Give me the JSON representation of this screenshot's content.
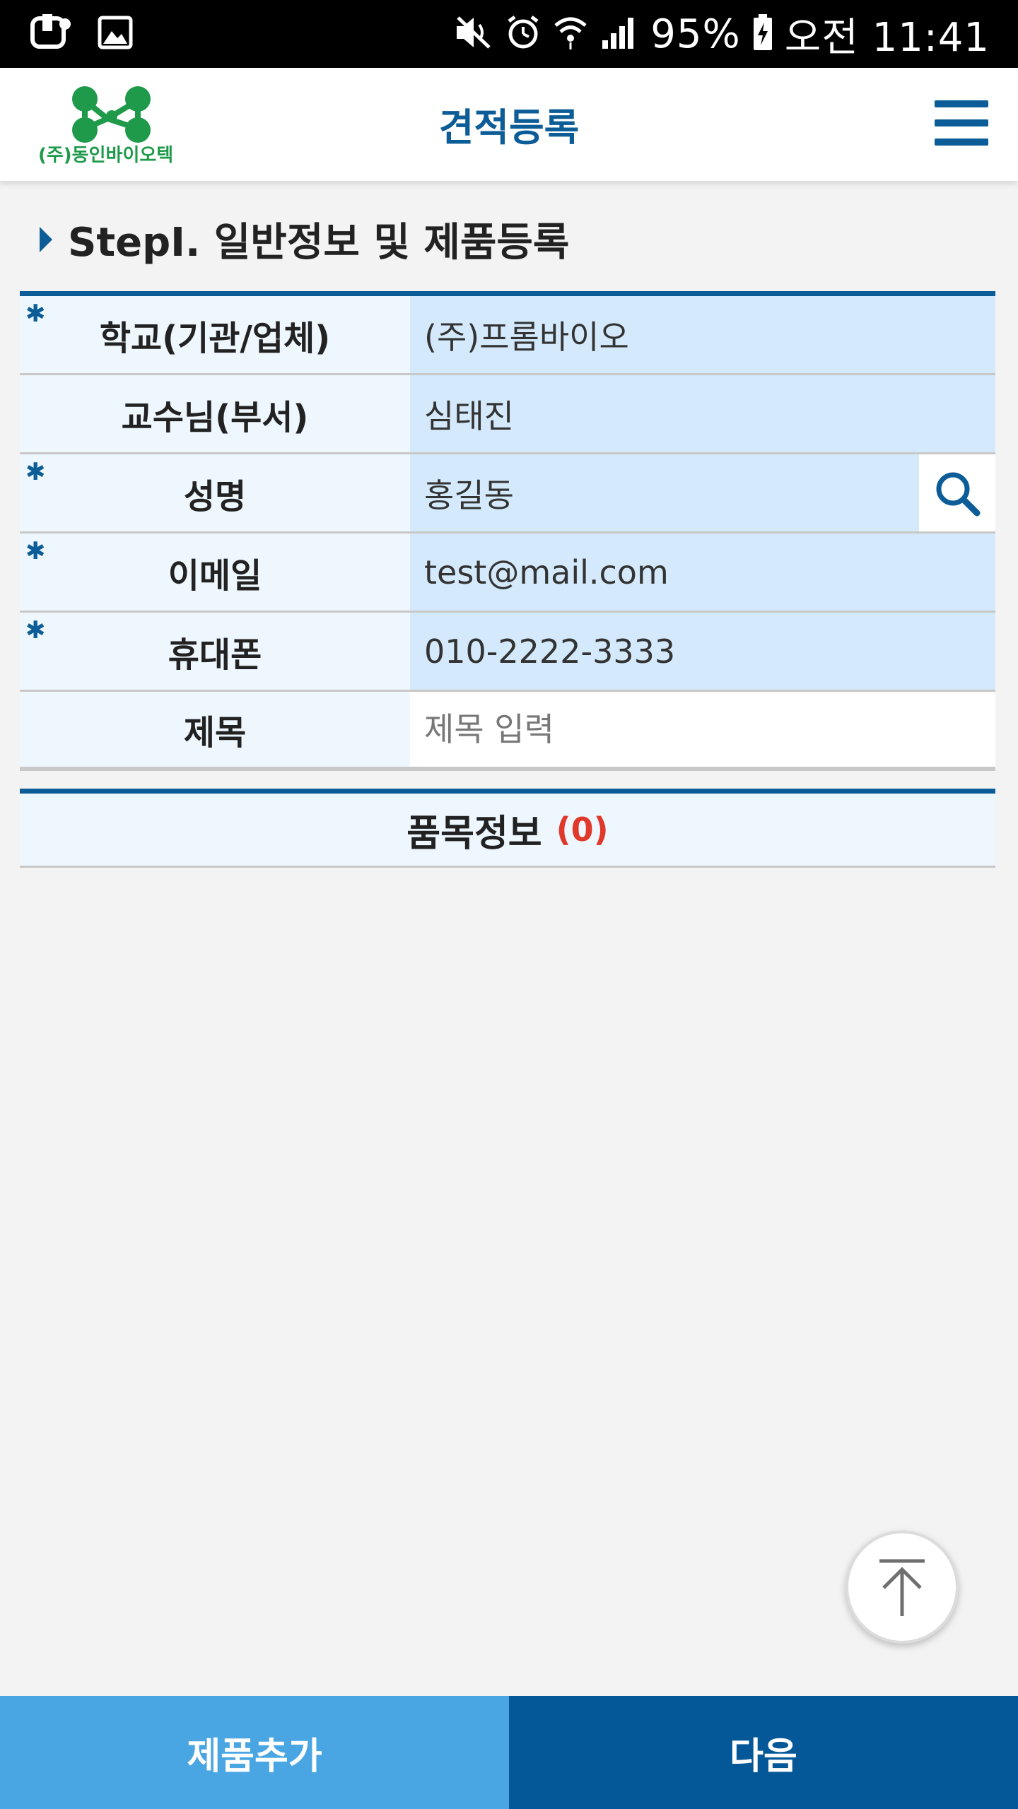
{
  "status_bar": {
    "battery": "95%",
    "time": "오전 11:41"
  },
  "header": {
    "logo_text": "(주)동인바이오텍",
    "title": "견적등록"
  },
  "section": {
    "title": "StepI. 일반정보 및 제품등록"
  },
  "form": {
    "rows": [
      {
        "label": "학교(기관/업체)",
        "value": "(주)프롬바이오",
        "required": true
      },
      {
        "label": "교수님(부서)",
        "value": "심태진",
        "required": false
      },
      {
        "label": "성명",
        "value": "홍길동",
        "required": true
      },
      {
        "label": "이메일",
        "value": "test@mail.com",
        "required": true
      },
      {
        "label": "휴대폰",
        "value": "010-2222-3333",
        "required": true
      },
      {
        "label": "제목",
        "placeholder": "제목 입력",
        "required": false
      }
    ]
  },
  "items": {
    "title": "품목정보",
    "count": "(0)"
  },
  "bottom": {
    "add_label": "제품추가",
    "next_label": "다음"
  },
  "colors": {
    "primary": "#0c5d97",
    "brand_green": "#1e9a4a",
    "count_red": "#e0382b",
    "add_button": "#4aa6e3",
    "next_button": "#045898"
  }
}
